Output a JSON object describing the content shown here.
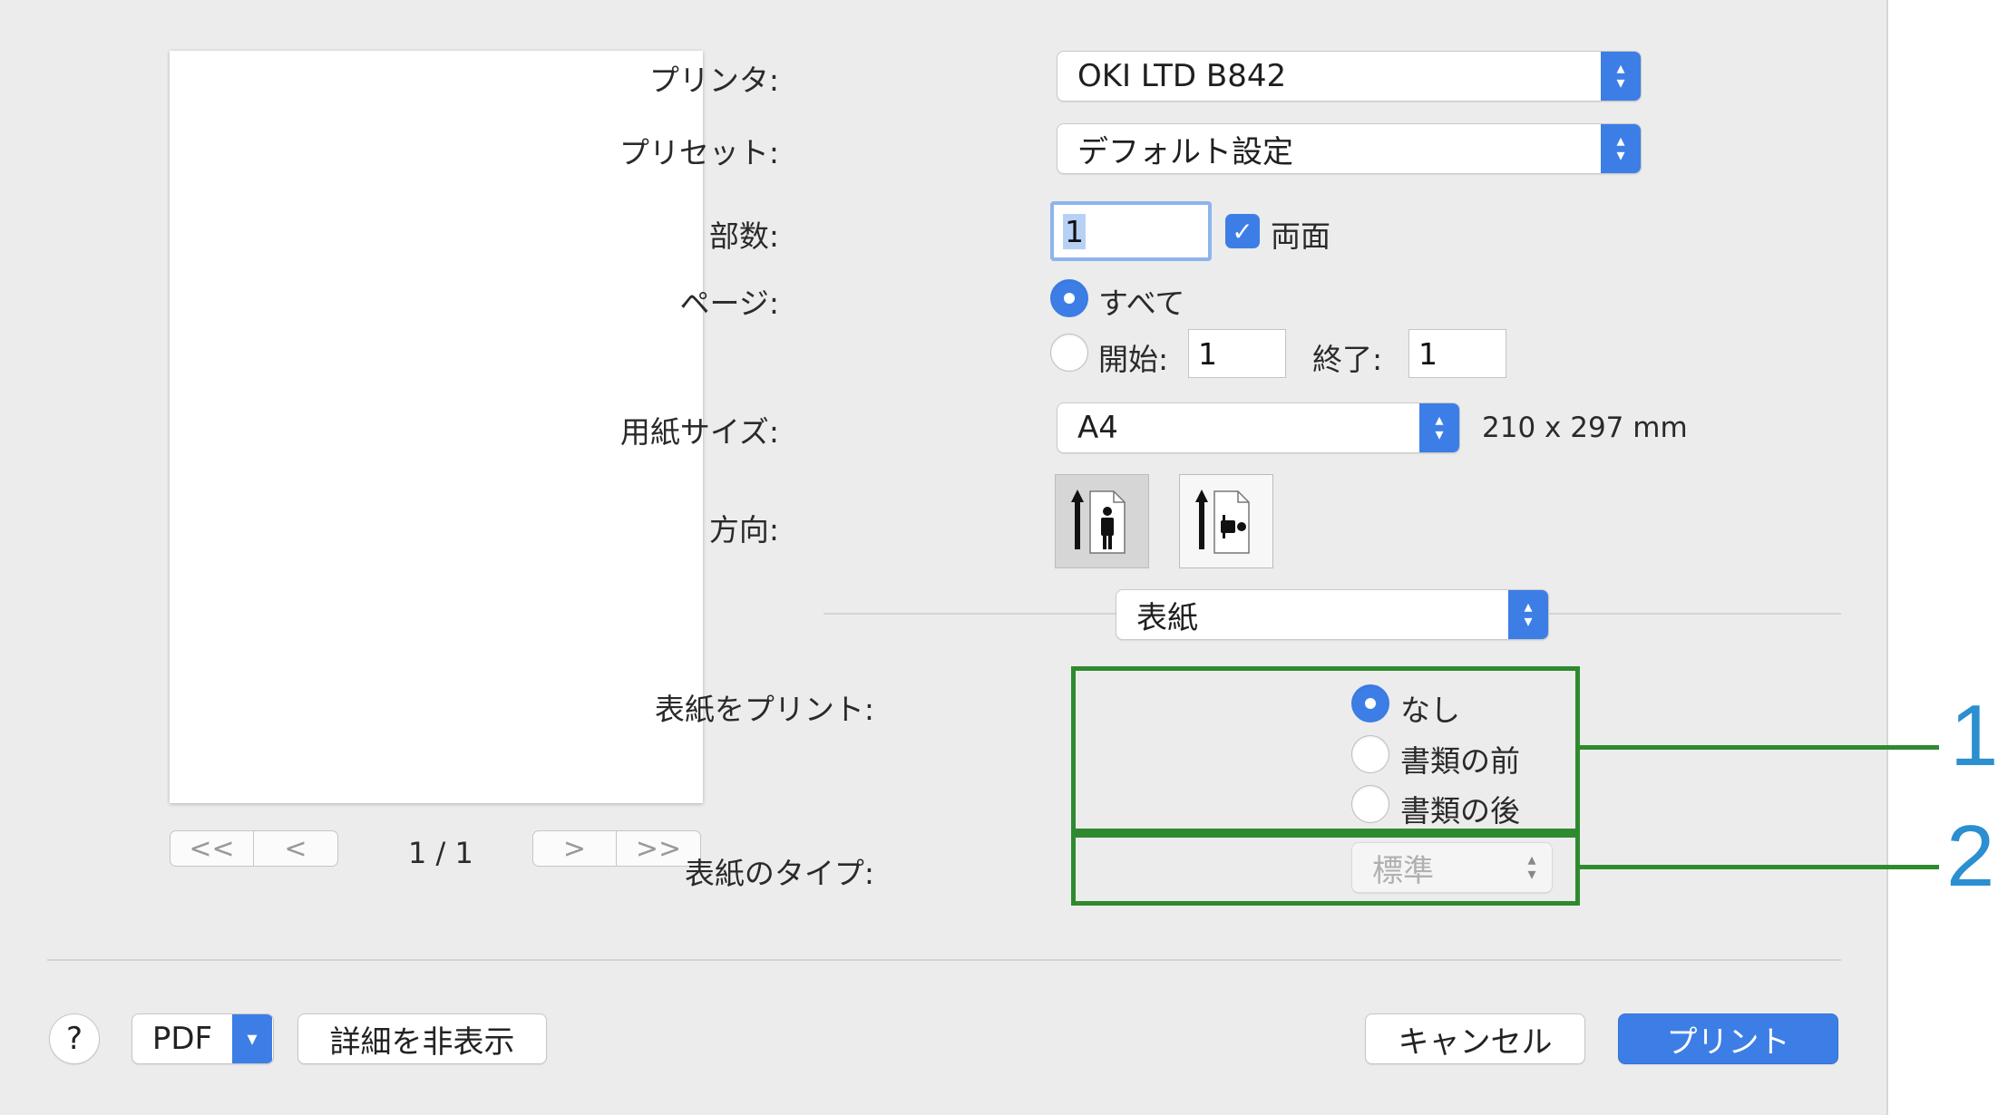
{
  "printer": {
    "label": "プリンタ:",
    "value": "OKI LTD B842"
  },
  "preset": {
    "label": "プリセット:",
    "value": "デフォルト設定"
  },
  "copies": {
    "label": "部数:",
    "value": "1",
    "duplex_label": "両面",
    "duplex_checked": true
  },
  "pages": {
    "label": "ページ:",
    "all_label": "すべて",
    "from_label": "開始:",
    "from_value": "1",
    "to_label": "終了:",
    "to_value": "1",
    "selected": "all"
  },
  "paper_size": {
    "label": "用紙サイズ:",
    "value": "A4",
    "dimensions": "210 x 297 mm"
  },
  "orientation": {
    "label": "方向:",
    "selected": "portrait"
  },
  "section_popup": {
    "value": "表紙"
  },
  "cover_print": {
    "label": "表紙をプリント:",
    "options": [
      "なし",
      "書類の前",
      "書類の後"
    ],
    "selected": 0
  },
  "cover_type": {
    "label": "表紙のタイプ:",
    "value": "標準"
  },
  "preview": {
    "page_indicator": "1 / 1",
    "first": "<<",
    "prev": "<",
    "next": ">",
    "last": ">>"
  },
  "callouts": [
    "1",
    "2"
  ],
  "footer": {
    "help": "?",
    "pdf": "PDF",
    "hide_details": "詳細を非表示",
    "cancel": "キャンセル",
    "print": "プリント"
  },
  "colors": {
    "accent": "#3d7ee6",
    "frame": "#2f8a2f",
    "callout": "#2b8fd0"
  }
}
